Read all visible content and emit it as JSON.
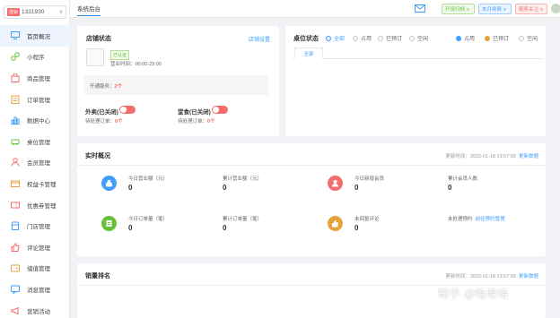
{
  "sidebar": {
    "store_tag": "连锁",
    "store_id": "1331930",
    "items": [
      {
        "label": "首页概况",
        "icon": "monitor-icon"
      },
      {
        "label": "小程序",
        "icon": "link-icon"
      },
      {
        "label": "商品管理",
        "icon": "bag-icon"
      },
      {
        "label": "订单管理",
        "icon": "order-icon"
      },
      {
        "label": "数据中心",
        "icon": "bar-chart-icon"
      },
      {
        "label": "桌位管理",
        "icon": "car-icon"
      },
      {
        "label": "会员管理",
        "icon": "user-icon"
      },
      {
        "label": "权益卡管理",
        "icon": "card-icon"
      },
      {
        "label": "优惠券管理",
        "icon": "coupon-icon"
      },
      {
        "label": "门店管理",
        "icon": "store-icon"
      },
      {
        "label": "评论管理",
        "icon": "thumb-icon"
      },
      {
        "label": "储值管理",
        "icon": "wallet-icon"
      },
      {
        "label": "消息管理",
        "icon": "message-icon"
      },
      {
        "label": "营销活动",
        "icon": "campaign-icon"
      }
    ]
  },
  "topbar": {
    "tab": "系统后台",
    "pill_green": "开设归档 ∨",
    "pill_blue": "本月续费 ∨",
    "pill_red": "服务关注 ∨"
  },
  "shop_status": {
    "title": "店铺状态",
    "link": "店铺设置",
    "auth_tag": "已认证",
    "hours": "营业时间：00:00-23:00",
    "services_label": "开通服务：",
    "services_count": "2个",
    "takeout_label": "外卖(已关闭)",
    "takeout_sub_label": "待处理订单：",
    "takeout_count": "0个",
    "dine_label": "堂食(已关闭)",
    "dine_sub_label": "待处理订单：",
    "dine_count": "0个"
  },
  "table_status": {
    "title": "桌位状态",
    "filters": [
      "全部",
      "占用",
      "已预订",
      "空闲"
    ],
    "legend": [
      {
        "label": "占用",
        "color": "#409eff"
      },
      {
        "label": "已预订",
        "color": "#e6a23c"
      },
      {
        "label": "空闲",
        "color": "#ffffff"
      }
    ],
    "tab": "全部"
  },
  "realtime": {
    "title": "实时概况",
    "update_label": "更新时间：",
    "update_time": "2022-01-18 13:57:55",
    "refresh": "更新数据",
    "stats": [
      {
        "label": "今日营业额（元）",
        "value": "0",
        "color": "#409eff",
        "icon": "money-bag-icon"
      },
      {
        "label": "累计营业额（元）",
        "value": "0"
      },
      {
        "label": "今日新增会员",
        "value": "0",
        "color": "#f56c6c",
        "icon": "member-icon"
      },
      {
        "label": "累计会员人数",
        "value": "0"
      },
      {
        "label": "今日订单量（笔）",
        "value": "0",
        "color": "#67c23a",
        "icon": "order-doc-icon"
      },
      {
        "label": "累计订单量（笔）",
        "value": "0"
      },
      {
        "label": "未回复评论",
        "value": "0",
        "color": "#e6a23c",
        "icon": "thumbs-up-icon"
      },
      {
        "label": "未处理预约",
        "link": "前往预约管理",
        "value": ""
      }
    ]
  },
  "ranking": {
    "title": "销量排名",
    "update_label": "更新时间：",
    "update_time": "2022-01-18 13:57:55",
    "refresh": "更新数据"
  },
  "watermark": "知乎 @哈哈哈"
}
